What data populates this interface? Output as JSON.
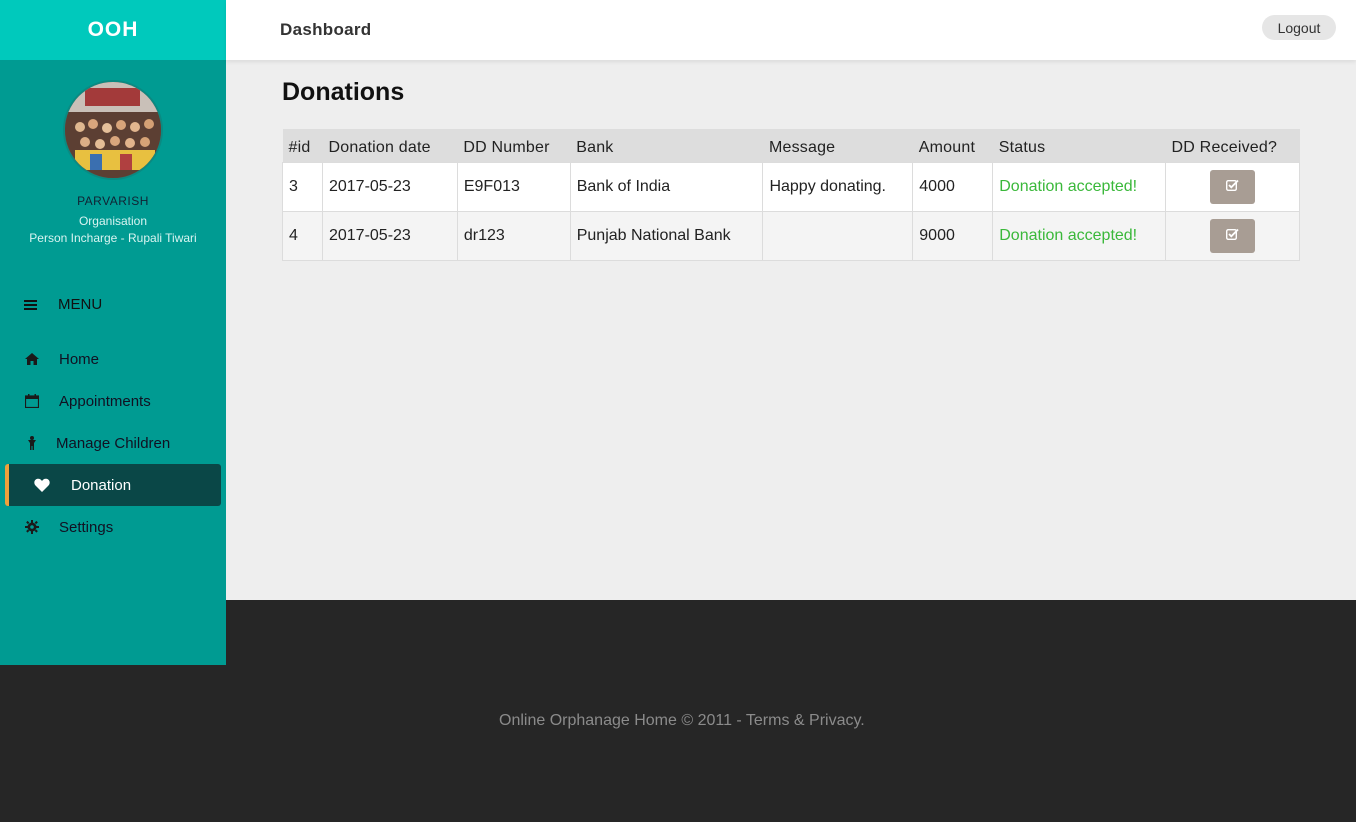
{
  "brand": "OOH",
  "profile": {
    "name": "PARVARISH",
    "type": "Organisation",
    "incharge": "Person Incharge - Rupali Tiwari"
  },
  "menu": {
    "header": "MENU",
    "items": [
      {
        "label": "Home",
        "icon": "home-icon"
      },
      {
        "label": "Appointments",
        "icon": "calendar-icon"
      },
      {
        "label": "Manage Children",
        "icon": "child-icon"
      },
      {
        "label": "Donation",
        "icon": "heart-icon",
        "active": true
      },
      {
        "label": "Settings",
        "icon": "gear-icon"
      }
    ]
  },
  "topbar": {
    "title": "Dashboard",
    "logout": "Logout"
  },
  "page": {
    "title": "Donations"
  },
  "table": {
    "headers": [
      "#id",
      "Donation date",
      "DD Number",
      "Bank",
      "Message",
      "Amount",
      "Status",
      "DD Received?"
    ],
    "rows": [
      {
        "id": "3",
        "date": "2017-05-23",
        "dd": "E9F013",
        "bank": "Bank of India",
        "message": "Happy donating.",
        "amount": "4000",
        "status": "Donation accepted!"
      },
      {
        "id": "4",
        "date": "2017-05-23",
        "dd": "dr123",
        "bank": "Punjab National Bank",
        "message": "",
        "amount": "9000",
        "status": "Donation accepted!"
      }
    ]
  },
  "footer": {
    "text": "Online Orphanage Home © 2011 - Terms & Privacy."
  },
  "colors": {
    "sidebar": "#009b92",
    "brand_bar": "#00c9bc",
    "active_item": "#0a4747",
    "active_accent": "#f0a13b",
    "status_ok": "#3ab83a",
    "footer": "#262626"
  }
}
